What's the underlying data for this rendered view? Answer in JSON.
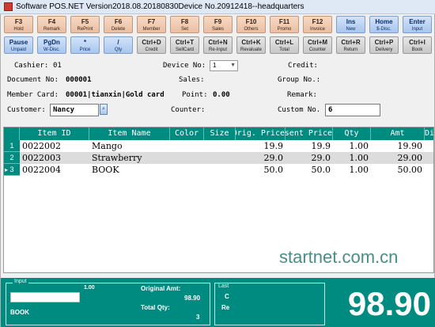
{
  "window": {
    "title": "Software POS.NET Version2018.08.20180830Device No.20912418--headquarters"
  },
  "function_keys_row1": [
    {
      "key": "F3",
      "label": "Hold"
    },
    {
      "key": "F4",
      "label": "Remark"
    },
    {
      "key": "F5",
      "label": "RePrint"
    },
    {
      "key": "F6",
      "label": "Delete"
    },
    {
      "key": "F7",
      "label": "Member"
    },
    {
      "key": "F8",
      "label": "Set"
    },
    {
      "key": "F9",
      "label": "Sales"
    },
    {
      "key": "F10",
      "label": "Others"
    },
    {
      "key": "F11",
      "label": "Promo"
    },
    {
      "key": "F12",
      "label": "Invoice"
    },
    {
      "key": "Ins",
      "label": "New"
    },
    {
      "key": "Home",
      "label": "$-Disc."
    },
    {
      "key": "Enter",
      "label": "Input"
    }
  ],
  "function_keys_row2": [
    {
      "key": "Pause",
      "label": "Unpaid"
    },
    {
      "key": "PgDn",
      "label": "W-Disc."
    },
    {
      "key": "*",
      "label": "Price"
    },
    {
      "key": "/",
      "label": "Qty"
    },
    {
      "key": "Ctrl+D",
      "label": "Credit"
    },
    {
      "key": "Ctrl+T",
      "label": "SellCard"
    },
    {
      "key": "Ctrl+N",
      "label": "Re-Input"
    },
    {
      "key": "Ctrl+K",
      "label": "Revaluate"
    },
    {
      "key": "Ctrl+L",
      "label": "Total"
    },
    {
      "key": "Ctrl+M",
      "label": "Counter"
    },
    {
      "key": "Ctrl+R",
      "label": "Return"
    },
    {
      "key": "Ctrl+P",
      "label": "Delivery"
    },
    {
      "key": "Ctrl+I",
      "label": "Book"
    }
  ],
  "header": {
    "cashier_label": "Cashier:",
    "cashier_value": "01",
    "device_label": "Device No:",
    "device_value": "1",
    "credit_label": "Credit:",
    "document_label": "Document No:",
    "document_value": "000001",
    "sales_label": "Sales:",
    "group_label": "Group No.:",
    "member_label": "Member Card:",
    "member_value": "00001|tianxin|Gold card",
    "point_label": "Point:",
    "point_value": "0.00",
    "remark_label": "Remark:",
    "customer_label": "Customer:",
    "customer_value": "Nancy",
    "counter_label": "Counter:",
    "custom_label": "Custom No.",
    "custom_value": "6"
  },
  "grid": {
    "columns": [
      "Item ID",
      "Item Name",
      "Color",
      "Size",
      "Orig. Price",
      "Present Price",
      "Qty",
      "Amt",
      "Discount"
    ],
    "rows": [
      {
        "num": "1",
        "id": "0022002",
        "name": "Mango",
        "color": "",
        "size": "",
        "orig": "19.9",
        "present": "19.9",
        "qty": "1.00",
        "amt": "19.90"
      },
      {
        "num": "2",
        "id": "0022003",
        "name": "Strawberry",
        "color": "",
        "size": "",
        "orig": "29.0",
        "present": "29.0",
        "qty": "1.00",
        "amt": "29.00"
      },
      {
        "num": "3",
        "id": "0022004",
        "name": "BOOK",
        "color": "",
        "size": "",
        "orig": "50.0",
        "present": "50.0",
        "qty": "1.00",
        "amt": "50.00"
      }
    ],
    "current_row_marker": "▸"
  },
  "watermark": "startnet.com.cn",
  "footer": {
    "input_caption": "Input",
    "input_qty": "1.00",
    "input_item": "BOOK",
    "original_amt_label": "Original Amt:",
    "original_amt_value": "98.90",
    "total_qty_label": "Total Qty:",
    "total_qty_value": "3",
    "last_caption": "Last",
    "last_line1": "C",
    "last_line2": "Re",
    "grand_total": "98.90"
  },
  "colors": {
    "teal": "#008b80",
    "tan_button": "#e9bfa3",
    "blue_button": "#a9c6ee",
    "gray_button": "#c8c8c8"
  }
}
